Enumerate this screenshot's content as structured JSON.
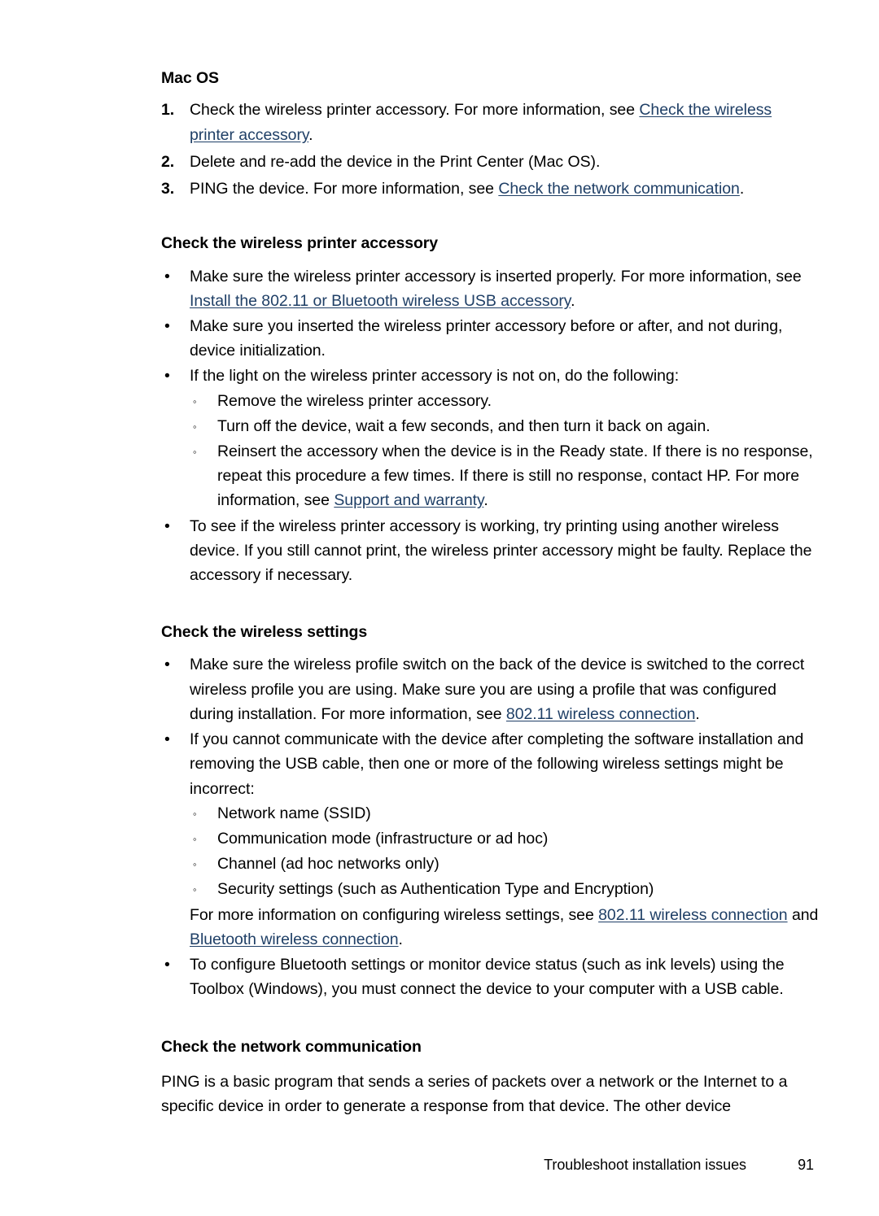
{
  "document": {
    "section_mac_os": {
      "heading": "Mac OS",
      "steps": [
        {
          "number": "1.",
          "text_before": "Check the wireless printer accessory. For more information, see ",
          "link": "Check the wireless printer accessory",
          "text_after": "."
        },
        {
          "number": "2.",
          "text_before": "Delete and re-add the device in the Print Center (Mac OS).",
          "link": "",
          "text_after": ""
        },
        {
          "number": "3.",
          "text_before": "PING the device. For more information, see ",
          "link": "Check the network communication",
          "text_after": "."
        }
      ]
    },
    "section_check_accessory": {
      "heading": "Check the wireless printer accessory",
      "bullet_marker": "•",
      "subbullet_marker": "◦",
      "bullets": [
        {
          "text_before": "Make sure the wireless printer accessory is inserted properly. For more information, see ",
          "link": "Install the 802.11 or Bluetooth wireless USB accessory",
          "text_after": "."
        },
        {
          "text_before": "Make sure you inserted the wireless printer accessory before or after, and not during, device initialization.",
          "link": "",
          "text_after": ""
        },
        {
          "text_before": "If the light on the wireless printer accessory is not on, do the following:",
          "link": "",
          "text_after": ""
        }
      ],
      "subbullets": [
        {
          "text_before": "Remove the wireless printer accessory.",
          "link": "",
          "text_after": ""
        },
        {
          "text_before": "Turn off the device, wait a few seconds, and then turn it back on again.",
          "link": "",
          "text_after": ""
        },
        {
          "text_before": "Reinsert the accessory when the device is in the Ready state. If there is no response, repeat this procedure a few times. If there is still no response, contact HP. For more information, see ",
          "link": "Support and warranty",
          "text_after": "."
        }
      ],
      "last_bullet": {
        "text_before": "To see if the wireless printer accessory is working, try printing using another wireless device. If you still cannot print, the wireless printer accessory might be faulty. Replace the accessory if necessary.",
        "link": "",
        "text_after": ""
      }
    },
    "section_check_settings": {
      "heading": "Check the wireless settings",
      "bullet_marker": "•",
      "subbullet_marker": "◦",
      "bullets": [
        {
          "text_before": "Make sure the wireless profile switch on the back of the device is switched to the correct wireless profile you are using. Make sure you are using a profile that was configured during installation. For more information, see ",
          "link": "802.11 wireless connection",
          "text_after": "."
        },
        {
          "text_before": "If you cannot communicate with the device after completing the software installation and removing the USB cable, then one or more of the following wireless settings might be incorrect:",
          "link": "",
          "text_after": ""
        }
      ],
      "subbullets": [
        "Network name (SSID)",
        "Communication mode (infrastructure or ad hoc)",
        "Channel (ad hoc networks only)",
        "Security settings (such as Authentication Type and Encryption)"
      ],
      "continuation": {
        "text_before": "For more information on configuring wireless settings, see ",
        "link1": "802.11 wireless connection",
        "text_middle": " and ",
        "link2": "Bluetooth wireless connection",
        "text_after": "."
      },
      "last_bullet": {
        "text_before": "To configure Bluetooth settings or monitor device status (such as ink levels) using the Toolbox (Windows), you must connect the device to your computer with a USB cable.",
        "link": "",
        "text_after": ""
      }
    },
    "section_network_communication": {
      "heading": "Check the network communication",
      "paragraph": "PING is a basic program that sends a series of packets over a network or the Internet to a specific device in order to generate a response from that device. The other device"
    },
    "footer": {
      "title": "Troubleshoot installation issues",
      "page_number": "91"
    }
  }
}
